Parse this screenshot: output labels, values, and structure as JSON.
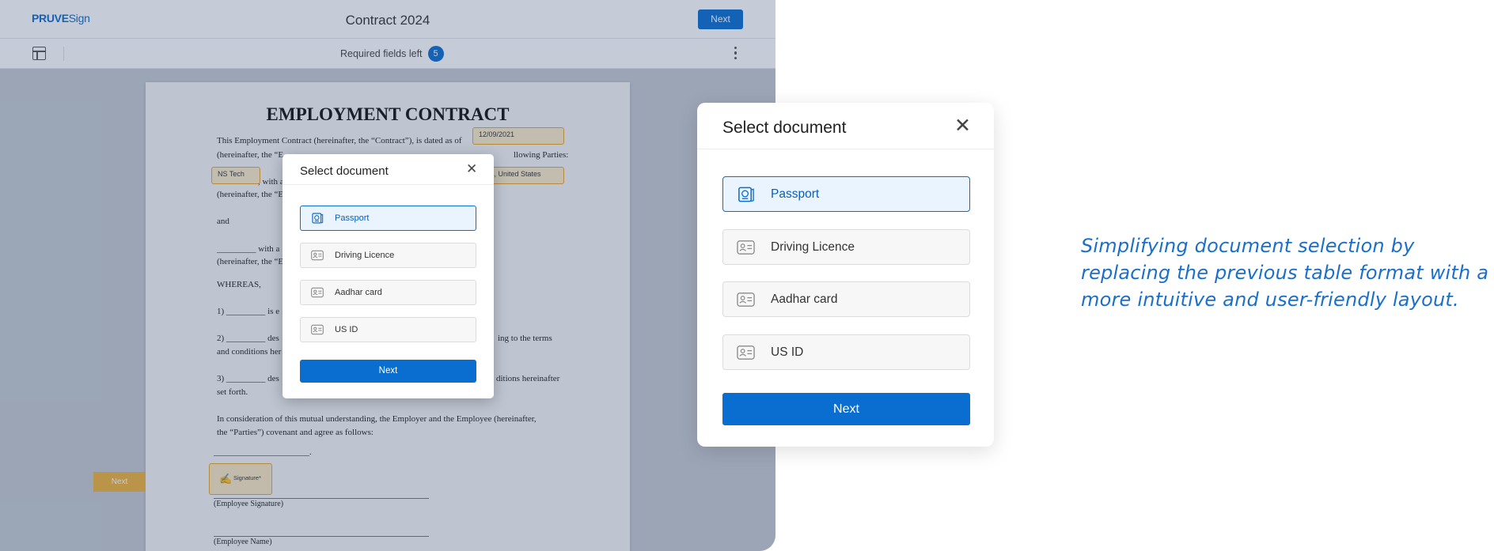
{
  "app": {
    "logo_bold": "PRUVE",
    "logo_thin": "Sign",
    "title": "Contract 2024",
    "top_next": "Next",
    "required_label": "Required fields left",
    "required_count": "5",
    "side_next": "Next"
  },
  "contract": {
    "heading": "EMPLOYMENT CONTRACT",
    "line1": "This Employment Contract (hereinafter, the “Contract”), is dated as of",
    "line2_start": "(hereinafter, the “E",
    "line2_end": "llowing Parties:",
    "line3_mid": ", with a",
    "line4": "(hereinafter, the “E",
    "line5": "and",
    "line6": "_________ with a",
    "line7": "(hereinafter, the “E",
    "line8": "WHEREAS,",
    "line9": "1) _________ is e",
    "line10_start": "2) _________ des",
    "line10_end": "ing to the terms",
    "line11": "and conditions her",
    "line12_start": "3) _________ des",
    "line12_end": "ditions hereinafter",
    "line13": "set forth.",
    "line14": "In consideration of this mutual understanding, the Employer and the Employee (hereinafter,",
    "line15": "the “Parties”) covenant and agree as follows:",
    "line16": "______________________.",
    "sig1": "(Employee Signature)",
    "sig2": "(Employee Name)",
    "field_date": "12/09/2021",
    "field_company": "NS Tech",
    "field_address": "s, United States",
    "field_signature": "Signature*"
  },
  "small_modal": {
    "title": "Select document",
    "options": [
      {
        "label": "Passport",
        "icon": "passport-icon",
        "selected": true
      },
      {
        "label": "Driving Licence",
        "icon": "id-card-icon",
        "selected": false
      },
      {
        "label": "Aadhar card",
        "icon": "id-card-icon",
        "selected": false
      },
      {
        "label": "US ID",
        "icon": "id-card-icon",
        "selected": false
      }
    ],
    "next": "Next"
  },
  "large_modal": {
    "title": "Select document",
    "options": [
      {
        "label": "Passport",
        "icon": "passport-icon",
        "selected": true
      },
      {
        "label": "Driving Licence",
        "icon": "id-card-icon",
        "selected": false
      },
      {
        "label": "Aadhar card",
        "icon": "id-card-icon",
        "selected": false
      },
      {
        "label": "US ID",
        "icon": "id-card-icon",
        "selected": false
      }
    ],
    "next": "Next"
  },
  "caption": "Simplifying document selection by replacing the previous table format with a more intuitive and user-friendly layout.",
  "colors": {
    "accent": "#0a6ed1",
    "field_border": "#e8a72c",
    "caption": "#1a6fcb"
  }
}
